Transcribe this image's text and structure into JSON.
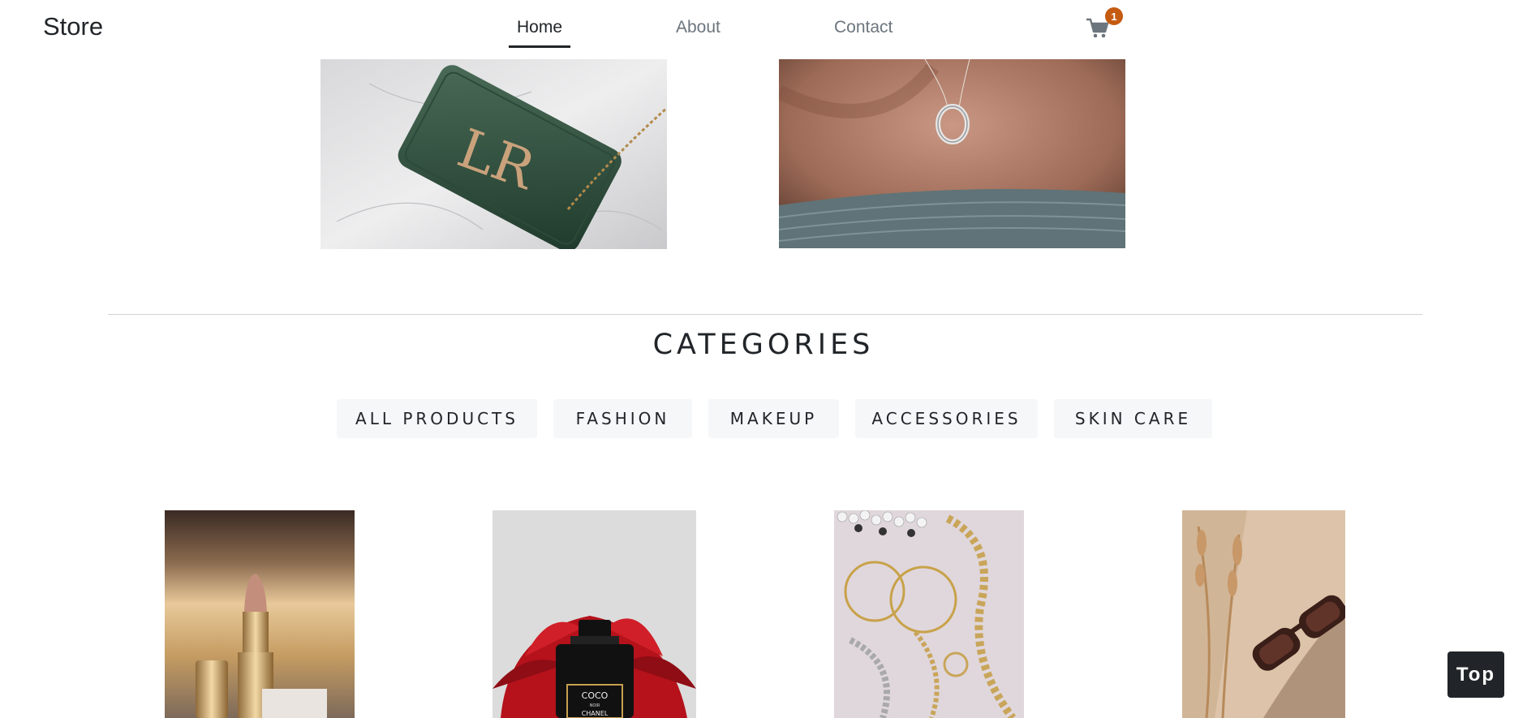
{
  "navbar": {
    "brand": "Store",
    "links": [
      {
        "label": "Home",
        "active": true
      },
      {
        "label": "About",
        "active": false
      },
      {
        "label": "Contact",
        "active": false
      }
    ],
    "cart": {
      "icon": "shopping-cart-icon",
      "count": "1",
      "badge_color": "#c55a11"
    }
  },
  "hero_images": [
    {
      "subject": "green leather bag with LR logo on marble"
    },
    {
      "subject": "delicate circle pendant necklace"
    }
  ],
  "categories": {
    "title": "CATEGORIES",
    "buttons": [
      "ALL PRODUCTS",
      "FASHION",
      "MAKEUP",
      "ACCESSORIES",
      "SKIN CARE"
    ]
  },
  "products": [
    {
      "subject": "gold lipstick"
    },
    {
      "subject": "perfume bottle with red flower",
      "label_top": "COCO",
      "label_small": "NOIR",
      "label_brand": "CHANEL"
    },
    {
      "subject": "gold jewelry and pearls flat lay"
    },
    {
      "subject": "sunglasses with dried pampas grass"
    }
  ],
  "top_button": {
    "label": "Top"
  },
  "colors": {
    "text": "#212529",
    "muted": "#6c757d",
    "button_bg": "#f6f7f9"
  }
}
